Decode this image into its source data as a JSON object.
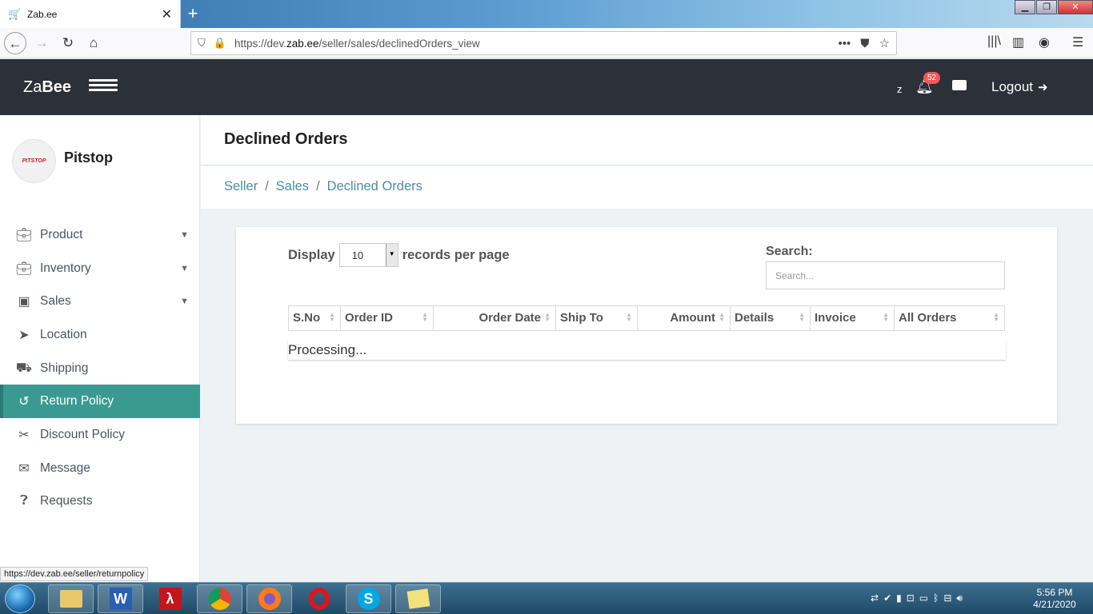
{
  "browser": {
    "tab_title": "Zab.ee",
    "url_prefix": "https://dev.",
    "url_domain": "zab.ee",
    "url_path": "/seller/sales/declinedOrders_view",
    "status_url": "https://dev.zab.ee/seller/returnpolicy"
  },
  "header": {
    "brand_light": "Za",
    "brand_bold": "Bee",
    "user_initial": "z",
    "notification_count": "52",
    "logout_label": "Logout"
  },
  "sidebar": {
    "store_name": "Pitstop",
    "logo_text": "PITSTOP",
    "items": [
      {
        "label": "Product",
        "icon": "briefcase-icon",
        "has_chevron": true
      },
      {
        "label": "Inventory",
        "icon": "briefcase-icon",
        "has_chevron": true
      },
      {
        "label": "Sales",
        "icon": "money-icon",
        "has_chevron": true
      },
      {
        "label": "Location",
        "icon": "location-arrow-icon",
        "has_chevron": false
      },
      {
        "label": "Shipping",
        "icon": "truck-icon",
        "has_chevron": false
      },
      {
        "label": "Return Policy",
        "icon": "undo-icon",
        "has_chevron": false,
        "active": true
      },
      {
        "label": "Discount Policy",
        "icon": "scissors-icon",
        "has_chevron": false
      },
      {
        "label": "Message",
        "icon": "envelope-icon",
        "has_chevron": false
      },
      {
        "label": "Requests",
        "icon": "question-circle-icon",
        "has_chevron": false
      }
    ]
  },
  "page": {
    "title": "Declined Orders",
    "breadcrumb": [
      "Seller",
      "Sales",
      "Declined Orders"
    ]
  },
  "table": {
    "length_prefix": "Display",
    "length_value": "10",
    "length_suffix": "records per page",
    "search_label": "Search:",
    "search_placeholder": "Search...",
    "columns": [
      "S.No",
      "Order ID",
      "Order Date",
      "Ship To",
      "Amount",
      "Details",
      "Invoice",
      "All Orders"
    ],
    "processing_text": "Processing..."
  },
  "taskbar": {
    "time": "5:56 PM",
    "date": "4/21/2020"
  },
  "colors": {
    "header_bg": "#2c3038",
    "accent": "#3a9a92",
    "badge": "#ef5a5a",
    "breadcrumb": "#4e8e9a"
  }
}
